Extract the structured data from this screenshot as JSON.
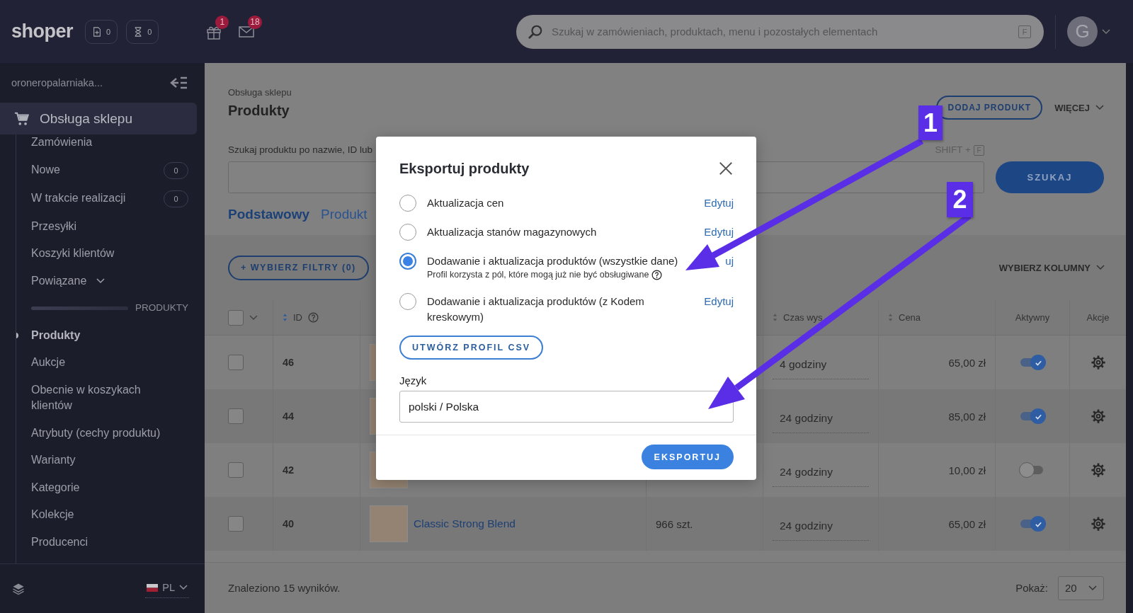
{
  "topbar": {
    "logo": "shoper",
    "counters": [
      {
        "kind": "document",
        "value": "0"
      },
      {
        "kind": "hourglass",
        "value": "0"
      }
    ],
    "notifications": [
      {
        "kind": "gift",
        "count": "1"
      },
      {
        "kind": "mail",
        "count": "18"
      }
    ],
    "search": {
      "placeholder": "Szukaj w zamówieniach, produktach, menu i pozostałych elementach",
      "shortcut": "F"
    },
    "avatar": "G"
  },
  "sidebar": {
    "shop_name": "oroneropalarniaka...",
    "section": "Obsługa sklepu",
    "items": [
      {
        "label": "Zamówienia",
        "kind": "link",
        "selected": false
      },
      {
        "label": "Nowe",
        "kind": "counter",
        "count": "0",
        "selected": false
      },
      {
        "label": "W trakcie realizacji",
        "kind": "counter",
        "count": "0",
        "selected": false
      },
      {
        "label": "Przesyłki",
        "kind": "link",
        "selected": false
      },
      {
        "label": "Koszyki klientów",
        "kind": "link",
        "selected": false
      },
      {
        "label": "Powiązane",
        "kind": "dropdown",
        "expanded": false,
        "selected": false
      },
      {
        "label": "PRODUKTY",
        "kind": "heading"
      },
      {
        "label": "Produkty",
        "kind": "link",
        "selected": true
      },
      {
        "label": "Aukcje",
        "kind": "link",
        "selected": false
      },
      {
        "label": "Obecnie w koszykach klientów",
        "kind": "link",
        "selected": false
      },
      {
        "label": "Atrybuty (cechy produktu)",
        "kind": "link",
        "selected": false
      },
      {
        "label": "Warianty",
        "kind": "link",
        "selected": false
      },
      {
        "label": "Kategorie",
        "kind": "link",
        "selected": false
      },
      {
        "label": "Kolekcje",
        "kind": "link",
        "selected": false
      },
      {
        "label": "Producenci",
        "kind": "link",
        "selected": false
      }
    ],
    "language": "PL"
  },
  "main": {
    "breadcrumb": "Obsługa sklepu",
    "title": "Produkty",
    "add_button": "DODAJ PRODUKT",
    "more_button": "WIĘCEJ",
    "search_label": "Szukaj produktu po nazwie, ID lub",
    "shortcut_label": "SHIFT +",
    "shortcut_key": "F",
    "search_button": "SZUKAJ",
    "tabs": [
      {
        "label": "Podstawowy",
        "selected": true
      },
      {
        "label": "Produkt",
        "selected": false
      }
    ],
    "filters_button": "+ WYBIERZ FILTRY (0)",
    "columns_button": "WYBIERZ KOLUMNY"
  },
  "table": {
    "select_all": false,
    "columns": [
      {
        "label": "ID",
        "sortable": true,
        "help": true
      },
      {
        "label": "Czas wys",
        "sortable": true,
        "help": false
      },
      {
        "label": "Cena",
        "sortable": true,
        "help": false
      },
      {
        "label": "Aktywny",
        "sortable": false,
        "help": false
      },
      {
        "label": "Akcje",
        "sortable": false,
        "help": false
      }
    ],
    "rows": [
      {
        "id": "46",
        "checked": false,
        "shipping": "4 godziny",
        "price": "65,00 zł",
        "active": true
      },
      {
        "id": "44",
        "checked": false,
        "shipping": "24 godziny",
        "price": "85,00 zł",
        "active": true
      },
      {
        "id": "42",
        "checked": false,
        "shipping": "24 godziny",
        "price": "10,00 zł",
        "active": false
      },
      {
        "id": "40",
        "checked": false,
        "name": "Classic Strong Blend",
        "stock": "966 szt.",
        "shipping": "24 godziny",
        "price": "65,00 zł",
        "active": true
      }
    ]
  },
  "footer": {
    "results": "Znaleziono 15 wyników.",
    "page_size_label": "Pokaż:",
    "page_size": "20"
  },
  "modal": {
    "title": "Eksportuj produkty",
    "options": [
      {
        "label": "Aktualizacja cen",
        "selected": false,
        "edit": "Edytuj"
      },
      {
        "label": "Aktualizacja stanów magazynowych",
        "selected": false,
        "edit": "Edytuj"
      },
      {
        "label": "Dodawanie i aktualizacja produktów (wszystkie dane)",
        "note": "Profil korzysta z pól, które mogą już nie być obsługiwane",
        "selected": true,
        "edit": "uj"
      },
      {
        "label": "Dodawanie i aktualizacja produktów (z Kodem kreskowym)",
        "selected": false,
        "edit": "Edytuj"
      }
    ],
    "create_button": "UTWÓRZ PROFIL CSV",
    "language_label": "Język",
    "language_value": "polski / Polska",
    "export_button": "EKSPORTUJ"
  },
  "annotations": [
    {
      "number": "1"
    },
    {
      "number": "2"
    }
  ]
}
